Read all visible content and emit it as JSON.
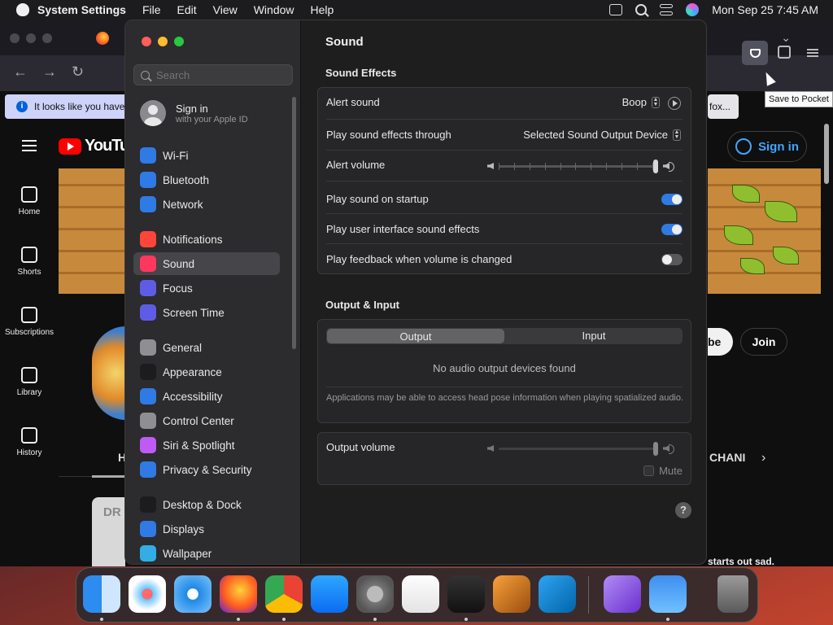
{
  "menubar": {
    "app_name": "System Settings",
    "menus": [
      "File",
      "Edit",
      "View",
      "Window",
      "Help"
    ],
    "datetime": "Mon Sep 25  7:45 AM"
  },
  "firefox": {
    "notification": "It looks like you have",
    "notification_button": "fox...",
    "tooltip": "Save to Pocket"
  },
  "youtube": {
    "logo": "YouTube",
    "sign_in": "Sign in",
    "nav": [
      "Home",
      "Shorts",
      "Subscriptions",
      "Library",
      "History"
    ],
    "subscribe_partial": "be",
    "join": "Join",
    "tab_partial": "H",
    "channels_partial": "CHANI",
    "thumb_text": "DR",
    "video_title_partial": "starts out sad."
  },
  "settings": {
    "search_placeholder": "Search",
    "account": {
      "title": "Sign in",
      "subtitle": "with your Apple ID"
    },
    "sidebar": [
      {
        "label": "Wi-Fi",
        "icon": "wifi-icon",
        "color": "#2f7ae5"
      },
      {
        "label": "Bluetooth",
        "icon": "bluetooth-icon",
        "color": "#2f7ae5"
      },
      {
        "label": "Network",
        "icon": "globe-icon",
        "color": "#2f7ae5"
      },
      {
        "label": "Notifications",
        "icon": "bell-icon",
        "color": "#ff453a"
      },
      {
        "label": "Sound",
        "icon": "speaker-icon",
        "color": "#ff375f"
      },
      {
        "label": "Focus",
        "icon": "moon-icon",
        "color": "#5e5ce6"
      },
      {
        "label": "Screen Time",
        "icon": "hourglass-icon",
        "color": "#5e5ce6"
      },
      {
        "label": "General",
        "icon": "gear-icon",
        "color": "#8e8e93"
      },
      {
        "label": "Appearance",
        "icon": "appearance-icon",
        "color": "#1c1c1e"
      },
      {
        "label": "Accessibility",
        "icon": "accessibility-icon",
        "color": "#2f7ae5"
      },
      {
        "label": "Control Center",
        "icon": "control-center-icon",
        "color": "#8e8e93"
      },
      {
        "label": "Siri & Spotlight",
        "icon": "siri-icon",
        "color": "#bf5af2"
      },
      {
        "label": "Privacy & Security",
        "icon": "hand-icon",
        "color": "#2f7ae5"
      },
      {
        "label": "Desktop & Dock",
        "icon": "dock-icon",
        "color": "#1c1c1e"
      },
      {
        "label": "Displays",
        "icon": "display-icon",
        "color": "#2f7ae5"
      },
      {
        "label": "Wallpaper",
        "icon": "wallpaper-icon",
        "color": "#32ade6"
      }
    ],
    "title": "Sound",
    "sound_effects": {
      "heading": "Sound Effects",
      "alert_sound_label": "Alert sound",
      "alert_sound_value": "Boop",
      "play_through_label": "Play sound effects through",
      "play_through_value": "Selected Sound Output Device",
      "alert_volume_label": "Alert volume",
      "alert_volume_level": 1.0,
      "startup_label": "Play sound on startup",
      "startup_on": true,
      "ui_sounds_label": "Play user interface sound effects",
      "ui_sounds_on": true,
      "feedback_label": "Play feedback when volume is changed",
      "feedback_on": false
    },
    "output_input": {
      "heading": "Output & Input",
      "tabs": [
        "Output",
        "Input"
      ],
      "selected_tab": "Output",
      "empty_message": "No audio output devices found",
      "note": "Applications may be able to access head pose information when playing spatialized audio.",
      "output_volume_label": "Output volume",
      "output_volume_level": 1.0,
      "mute_label": "Mute"
    },
    "help": "?"
  },
  "dock": [
    {
      "name": "Finder",
      "icon": "finder-icon",
      "running": true
    },
    {
      "name": "Launchpad",
      "icon": "launchpad-icon",
      "running": false
    },
    {
      "name": "Safari",
      "icon": "safari-icon",
      "running": false
    },
    {
      "name": "Firefox",
      "icon": "firefox-icon",
      "running": true
    },
    {
      "name": "Chrome",
      "icon": "chrome-icon",
      "running": true
    },
    {
      "name": "App Store",
      "icon": "app-store-icon",
      "running": false
    },
    {
      "name": "System Settings",
      "icon": "system-settings-icon",
      "running": true
    },
    {
      "name": "TextEdit",
      "icon": "textedit-icon",
      "running": false
    },
    {
      "name": "Terminal",
      "icon": "terminal-icon",
      "running": true
    },
    {
      "name": "GarageBand",
      "icon": "garageband-icon",
      "running": false
    },
    {
      "name": "Visual Studio Code",
      "icon": "vscode-icon",
      "running": false
    },
    {
      "name": "Visual Studio",
      "icon": "visual-studio-icon",
      "running": false
    },
    {
      "name": "Weather",
      "icon": "weather-icon",
      "running": true
    },
    {
      "name": "Trash",
      "icon": "trash-icon",
      "running": false
    }
  ]
}
